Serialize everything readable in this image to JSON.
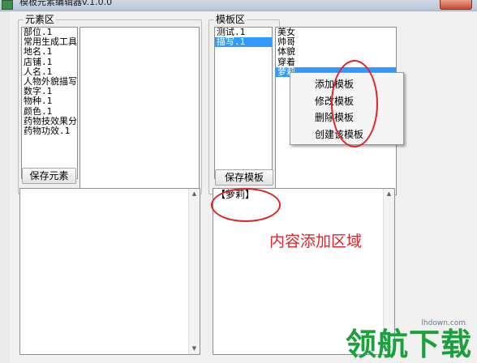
{
  "window": {
    "title": "模板元素编辑器v.1.0.0"
  },
  "element_group": {
    "label": "元素区",
    "items": [
      "部位.1",
      "常用生成工具",
      "地名.1",
      "店铺.1",
      "人名.1",
      "人物外貌描写",
      "数字.1",
      "物种.1",
      "颜色.1",
      "药物技效果分",
      "药物功效.1"
    ],
    "save_button": "保存元素"
  },
  "template_group": {
    "label": "模板区",
    "items": [
      {
        "label": "测试.1",
        "selected": false
      },
      {
        "label": "描写.1",
        "selected": true
      }
    ],
    "save_button": "保存模板",
    "sub_items": [
      {
        "label": "美女",
        "selected": false
      },
      {
        "label": "帅哥",
        "selected": false
      },
      {
        "label": "体貌",
        "selected": false
      },
      {
        "label": "穿着",
        "selected": false
      },
      {
        "label": "萝莉",
        "selected": true
      }
    ],
    "content_text": "【萝莉】"
  },
  "context_menu": {
    "items": [
      "添加模板",
      "修改模板",
      "删除模板",
      "创建该模板"
    ]
  },
  "annotation": {
    "label": "内容添加区域",
    "color": "#e0242b"
  },
  "watermark": {
    "url": "lhdown.com",
    "logo": "领航下载",
    "color": "#1c9f3d"
  },
  "colors": {
    "selection": "#3399ff"
  },
  "icons": {
    "scroll_up": "▲",
    "scroll_down": "▼"
  }
}
